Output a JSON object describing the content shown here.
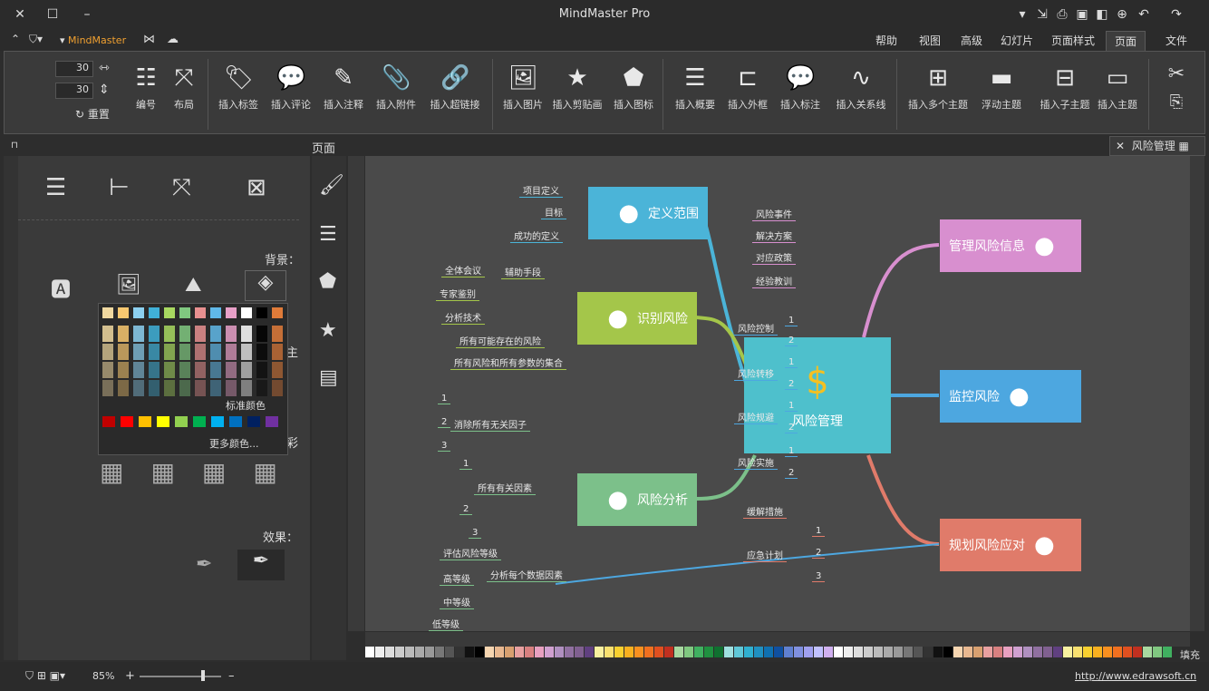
{
  "window": {
    "title": "MindMaster Pro",
    "brand": "MindMaster"
  },
  "tabs": [
    "文件",
    "页面",
    "页面样式",
    "幻灯片",
    "高级",
    "视图",
    "帮助"
  ],
  "active_tab": "页面",
  "ribbon": {
    "insert_topic": "插入主题",
    "insert_subtopic": "插入子主题",
    "float_topic": "浮动主题",
    "insert_multi": "插入多个主题",
    "insert_relation": "插入关系线",
    "insert_callout": "插入标注",
    "insert_boundary": "插入外框",
    "insert_summary": "插入概要",
    "insert_icon": "插入图标",
    "insert_clipart": "插入剪贴画",
    "insert_image": "插入图片",
    "insert_hyperlink": "插入超链接",
    "insert_attachment": "插入附件",
    "insert_note": "插入注释",
    "insert_comment": "插入评论",
    "insert_tag": "插入标签",
    "layout": "布局",
    "numbering": "编号",
    "spin1": "30",
    "spin2": "30",
    "reset": "重置"
  },
  "doc_tab": "风险管理",
  "panel": {
    "title": "页面",
    "bg_label": "背景：",
    "theme_label": "主",
    "color_label": "彩",
    "effect_label": "效果：",
    "std_color": "标准颜色",
    "more_color": "更多颜色..."
  },
  "colors": {
    "accent": "#e07b39",
    "canvas": "#4a4a4a"
  },
  "map": {
    "center": "风险管理",
    "left": [
      {
        "label": "定义范围",
        "color": "#4bb4d8",
        "leaves": [
          "项目定义",
          "目标",
          "成功的定义"
        ]
      },
      {
        "label": "识别风险",
        "color": "#a4c64a",
        "leaves": [
          "辅助手段",
          "全体会议",
          "专家鉴别",
          "分析技术",
          "所有可能存在的风险",
          "所有风险和所有参数的集合"
        ]
      },
      {
        "label": "风险分析",
        "color": "#7cc08a",
        "leaves": [
          "消除所有无关因子",
          "1",
          "2",
          "3",
          "所有有关因素",
          "1",
          "2",
          "3",
          "分析每个数据因素",
          "评估风险等级",
          "高等级",
          "中等级",
          "低等级"
        ]
      }
    ],
    "right": [
      {
        "label": "管理风险信息",
        "color": "#d88fcf",
        "leaves": [
          "风险事件",
          "解决方案",
          "对应政策",
          "经验教训"
        ]
      },
      {
        "label": "监控风险",
        "color": "#4da7e0",
        "leaves": [
          "风险控制",
          "1",
          "2",
          "风险转移",
          "1",
          "2",
          "风险规避",
          "1",
          "2",
          "风险实施",
          "1",
          "2"
        ]
      },
      {
        "label": "规划风险应对",
        "color": "#e07b6a",
        "leaves": [
          "缓解措施",
          "应急计划",
          "1",
          "2",
          "3"
        ]
      }
    ]
  },
  "status": {
    "zoom": "85%",
    "url": "http://www.edrawsoft.cn",
    "fill": "填充"
  }
}
